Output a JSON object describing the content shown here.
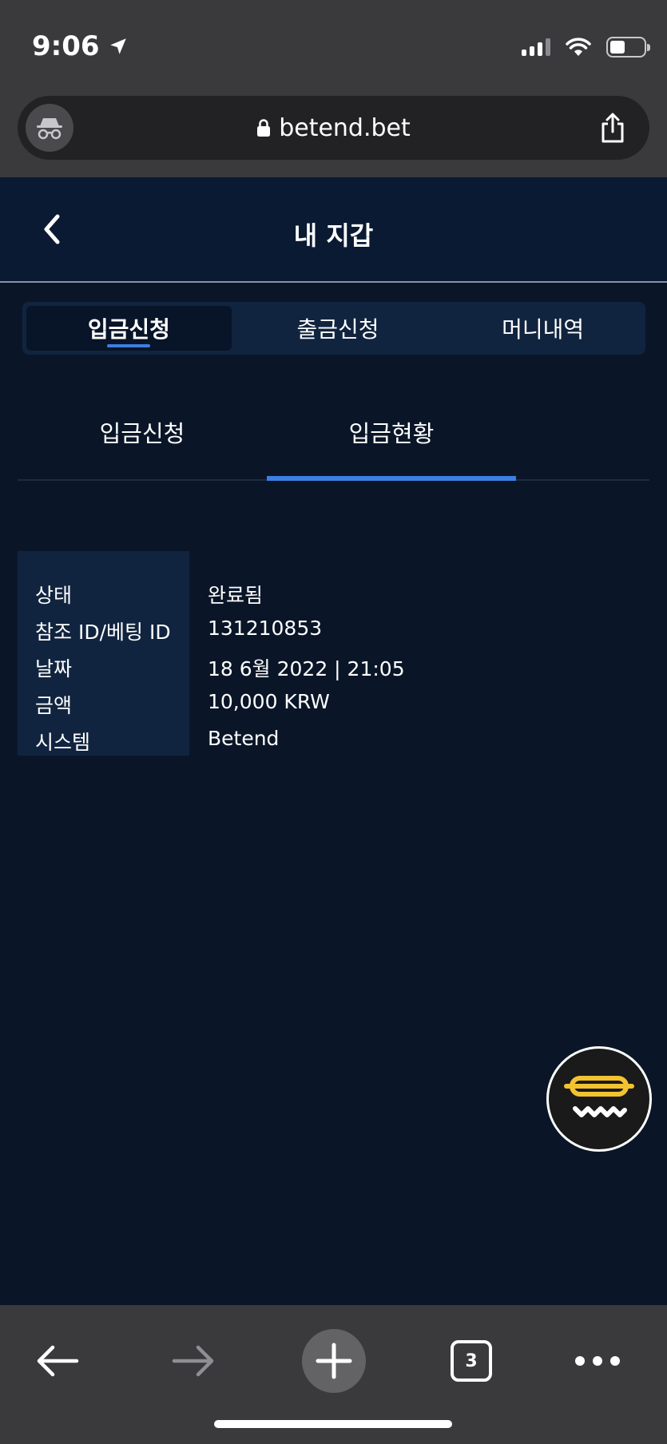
{
  "status_bar": {
    "time": "9:06"
  },
  "browser": {
    "url": "betend.bet",
    "tab_count": "3"
  },
  "header": {
    "title": "내 지갑"
  },
  "main_tabs": [
    {
      "label": "입금신청",
      "active": true
    },
    {
      "label": "출금신청",
      "active": false
    },
    {
      "label": "머니내역",
      "active": false
    }
  ],
  "sub_tabs": [
    {
      "label": "입금신청",
      "active": false
    },
    {
      "label": "입금현황",
      "active": true
    }
  ],
  "details": [
    {
      "label": "상태",
      "value": "완료됨"
    },
    {
      "label": "참조 ID/베팅 ID",
      "value": "131210853"
    },
    {
      "label": "날짜",
      "value": "18 6월 2022 | 21:05"
    },
    {
      "label": "금액",
      "value": "10,000 KRW"
    },
    {
      "label": "시스템",
      "value": "Betend"
    }
  ],
  "colors": {
    "background": "#0a1628",
    "panel": "#11243f",
    "accent": "#3d7fe0",
    "fab_yellow": "#f2c230"
  }
}
